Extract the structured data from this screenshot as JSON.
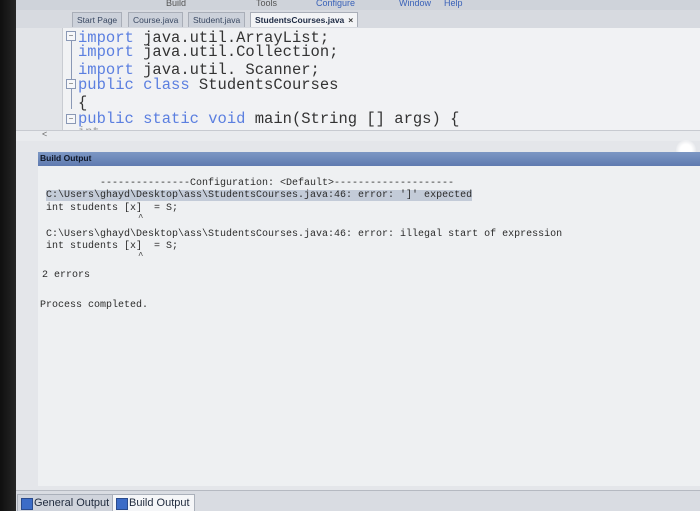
{
  "menu": {
    "build": "Build",
    "tools": "Tools",
    "configure": "Configure",
    "window": "Window",
    "help": "Help"
  },
  "tabs": [
    {
      "label": "Start Page"
    },
    {
      "label": "Course.java"
    },
    {
      "label": "Student.java"
    },
    {
      "label": "StudentsCourses.java"
    }
  ],
  "tab_close_glyph": "×",
  "editor": {
    "lines": [
      {
        "keyword": "import",
        "rest": " java.util.ArrayList;"
      },
      {
        "keyword": "import",
        "rest": " java.util.Collection;"
      },
      {
        "keyword": "import",
        "rest": " java.util. Scanner;"
      },
      {
        "keyword": "public class",
        "rest": " StudentsCourses"
      },
      {
        "keyword": "",
        "rest": "{"
      },
      {
        "keyword": "public static void",
        "rest": " main(String [] args) {"
      },
      {
        "keyword": "",
        "rest": "int  ..  ._"
      }
    ],
    "scroll_glyph": "<"
  },
  "output": {
    "title": "Build Output",
    "lines": [
      "---------------Configuration: <Default>--------------------",
      "C:\\Users\\ghayd\\Desktop\\ass\\StudentsCourses.java:46: error: ']' expected",
      "int students [x]  = S;",
      "C:\\Users\\ghayd\\Desktop\\ass\\StudentsCourses.java:46: error: illegal start of expression",
      "int students [x]  = S;",
      "2 errors",
      "Process completed."
    ],
    "caret_glyph": "^"
  },
  "bottom_tabs": [
    {
      "label": "General Output"
    },
    {
      "label": "Build Output"
    }
  ]
}
